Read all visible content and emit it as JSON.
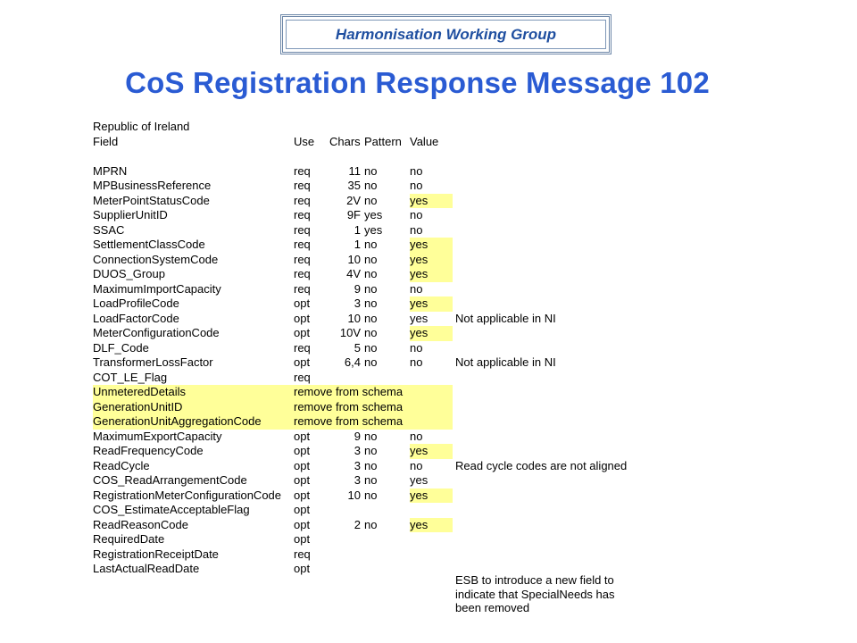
{
  "header": {
    "banner": "Harmonisation Working Group",
    "title": "CoS Registration Response Message 102"
  },
  "sheet": {
    "section": "Republic of Ireland",
    "columns": {
      "field": "Field",
      "use": "Use",
      "chars": "Chars",
      "pattern": "Pattern",
      "value": "Value"
    },
    "rows": [
      {
        "field": "",
        "use": "",
        "chars": "",
        "pattern": "",
        "value": "",
        "note": "",
        "hl_value": false,
        "remove": false
      },
      {
        "field": "MPRN",
        "use": "req",
        "chars": "11",
        "pattern": "no",
        "value": "no",
        "note": "",
        "hl_value": false,
        "remove": false
      },
      {
        "field": "MPBusinessReference",
        "use": "req",
        "chars": "35",
        "pattern": "no",
        "value": "no",
        "note": "",
        "hl_value": false,
        "remove": false
      },
      {
        "field": "MeterPointStatusCode",
        "use": "req",
        "chars": "2V",
        "pattern": "no",
        "value": "yes",
        "note": "",
        "hl_value": true,
        "remove": false
      },
      {
        "field": "SupplierUnitID",
        "use": "req",
        "chars": "9F",
        "pattern": "yes",
        "value": "no",
        "note": "",
        "hl_value": false,
        "remove": false
      },
      {
        "field": "SSAC",
        "use": "req",
        "chars": "1",
        "pattern": "yes",
        "value": "no",
        "note": "",
        "hl_value": false,
        "remove": false
      },
      {
        "field": "SettlementClassCode",
        "use": "req",
        "chars": "1",
        "pattern": "no",
        "value": "yes",
        "note": "",
        "hl_value": true,
        "remove": false
      },
      {
        "field": "ConnectionSystemCode",
        "use": "req",
        "chars": "10",
        "pattern": "no",
        "value": "yes",
        "note": "",
        "hl_value": true,
        "remove": false
      },
      {
        "field": "DUOS_Group",
        "use": "req",
        "chars": "4V",
        "pattern": "no",
        "value": "yes",
        "note": "",
        "hl_value": true,
        "remove": false
      },
      {
        "field": "MaximumImportCapacity",
        "use": "req",
        "chars": "9",
        "pattern": "no",
        "value": "no",
        "note": "",
        "hl_value": false,
        "remove": false
      },
      {
        "field": "LoadProfileCode",
        "use": "opt",
        "chars": "3",
        "pattern": "no",
        "value": "yes",
        "note": "",
        "hl_value": true,
        "remove": false
      },
      {
        "field": "LoadFactorCode",
        "use": "opt",
        "chars": "10",
        "pattern": "no",
        "value": "yes",
        "note": "Not applicable in NI",
        "hl_value": false,
        "remove": false
      },
      {
        "field": "MeterConfigurationCode",
        "use": "opt",
        "chars": "10V",
        "pattern": "no",
        "value": "yes",
        "note": "",
        "hl_value": true,
        "remove": false
      },
      {
        "field": "DLF_Code",
        "use": "req",
        "chars": "5",
        "pattern": "no",
        "value": "no",
        "note": "",
        "hl_value": false,
        "remove": false
      },
      {
        "field": "TransformerLossFactor",
        "use": "opt",
        "chars": "6,4",
        "pattern": "no",
        "value": "no",
        "note": "Not applicable in NI",
        "hl_value": false,
        "remove": false
      },
      {
        "field": "COT_LE_Flag",
        "use": "req",
        "chars": "",
        "pattern": "",
        "value": "",
        "note": "",
        "hl_value": false,
        "remove": false
      },
      {
        "field": "UnmeteredDetails",
        "use": "remove from schema",
        "chars": "",
        "pattern": "",
        "value": "",
        "note": "",
        "hl_value": false,
        "remove": true
      },
      {
        "field": "GenerationUnitID",
        "use": "remove from schema",
        "chars": "",
        "pattern": "",
        "value": "",
        "note": "",
        "hl_value": false,
        "remove": true
      },
      {
        "field": "GenerationUnitAggregationCode",
        "use": "remove from schema",
        "chars": "",
        "pattern": "",
        "value": "",
        "note": "",
        "hl_value": false,
        "remove": true
      },
      {
        "field": "MaximumExportCapacity",
        "use": "opt",
        "chars": "9",
        "pattern": "no",
        "value": "no",
        "note": "",
        "hl_value": false,
        "remove": false
      },
      {
        "field": "ReadFrequencyCode",
        "use": "opt",
        "chars": "3",
        "pattern": "no",
        "value": "yes",
        "note": "",
        "hl_value": true,
        "remove": false
      },
      {
        "field": "ReadCycle",
        "use": "opt",
        "chars": "3",
        "pattern": "no",
        "value": "no",
        "note": "Read cycle codes are not aligned",
        "hl_value": false,
        "remove": false
      },
      {
        "field": "COS_ReadArrangementCode",
        "use": "opt",
        "chars": "3",
        "pattern": "no",
        "value": "yes",
        "note": "",
        "hl_value": false,
        "remove": false
      },
      {
        "field": "RegistrationMeterConfigurationCode",
        "use": "opt",
        "chars": "10",
        "pattern": "no",
        "value": "yes",
        "note": "",
        "hl_value": true,
        "remove": false
      },
      {
        "field": "COS_EstimateAcceptableFlag",
        "use": "opt",
        "chars": "",
        "pattern": "",
        "value": "",
        "note": "",
        "hl_value": false,
        "remove": false
      },
      {
        "field": "ReadReasonCode",
        "use": "opt",
        "chars": "2",
        "pattern": "no",
        "value": "yes",
        "note": "",
        "hl_value": true,
        "remove": false
      },
      {
        "field": "RequiredDate",
        "use": "opt",
        "chars": "",
        "pattern": "",
        "value": "",
        "note": "",
        "hl_value": false,
        "remove": false
      },
      {
        "field": "RegistrationReceiptDate",
        "use": "req",
        "chars": "",
        "pattern": "",
        "value": "",
        "note": "",
        "hl_value": false,
        "remove": false
      },
      {
        "field": "LastActualReadDate",
        "use": "opt",
        "chars": "",
        "pattern": "",
        "value": "",
        "note": "",
        "hl_value": false,
        "remove": false
      }
    ],
    "bottom_note_lines": [
      "ESB to introduce a new field to",
      "indicate that SpecialNeeds has",
      "been removed"
    ]
  }
}
